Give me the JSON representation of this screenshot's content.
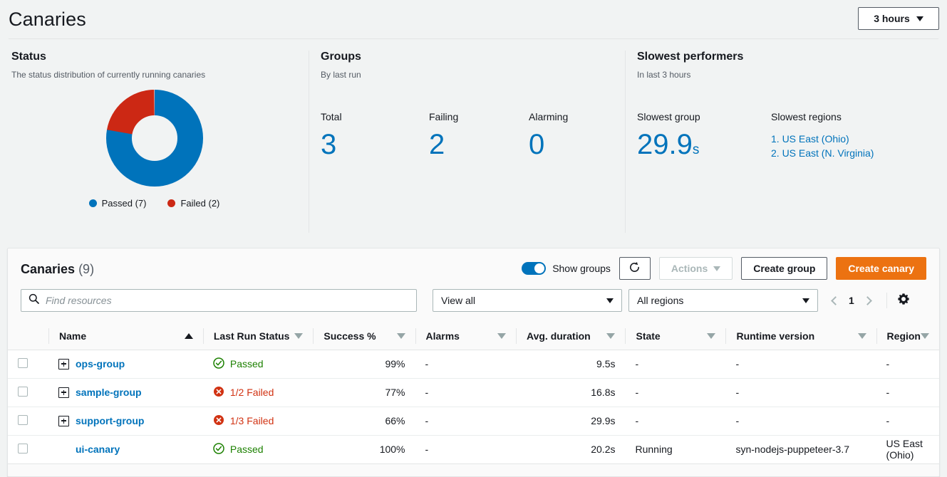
{
  "header": {
    "title": "Canaries",
    "time_range": "3 hours",
    "time_range_icon": "chevron-down-icon"
  },
  "status_panel": {
    "heading": "Status",
    "subheading": "The status distribution of currently running canaries"
  },
  "groups_panel": {
    "heading": "Groups",
    "subheading": "By last run",
    "metrics": [
      {
        "label": "Total",
        "value": "3"
      },
      {
        "label": "Failing",
        "value": "2",
        "icon": "warning-triangle-icon"
      },
      {
        "label": "Alarming",
        "value": "0"
      }
    ]
  },
  "performers_panel": {
    "heading": "Slowest performers",
    "subheading": "In last 3 hours",
    "slowest_group_label": "Slowest group",
    "slowest_group_value": "29.9",
    "slowest_group_unit": "s",
    "slowest_regions_label": "Slowest regions",
    "regions": [
      "1. US East (Ohio)",
      "2. US East (N. Virginia)"
    ]
  },
  "table_card": {
    "title": "Canaries",
    "count": "(9)",
    "toggle_label": "Show groups",
    "refresh_icon": "refresh-icon",
    "actions_label": "Actions",
    "create_group_label": "Create group",
    "create_canary_label": "Create canary",
    "search_placeholder": "Find resources",
    "search_value": "",
    "search_icon": "search-icon",
    "view_filter": "View all",
    "region_filter": "All regions",
    "page_number": "1",
    "settings_icon": "gear-icon",
    "columns": [
      {
        "label": "Name",
        "sort": "asc"
      },
      {
        "label": "Last Run Status",
        "sort": "none"
      },
      {
        "label": "Success %",
        "sort": "none"
      },
      {
        "label": "Alarms",
        "sort": "none"
      },
      {
        "label": "Avg. duration",
        "sort": "none"
      },
      {
        "label": "State",
        "sort": "none"
      },
      {
        "label": "Runtime version",
        "sort": "none"
      },
      {
        "label": "Region",
        "sort": "none"
      }
    ],
    "rows": [
      {
        "name": "ops-group",
        "is_group": true,
        "status": "Passed",
        "status_kind": "passed",
        "success": "99%",
        "alarms": "-",
        "duration": "9.5s",
        "state": "-",
        "runtime": "-",
        "region": "-"
      },
      {
        "name": "sample-group",
        "is_group": true,
        "status": "1/2 Failed",
        "status_kind": "failed",
        "success": "77%",
        "alarms": "-",
        "duration": "16.8s",
        "state": "-",
        "runtime": "-",
        "region": "-"
      },
      {
        "name": "support-group",
        "is_group": true,
        "status": "1/3 Failed",
        "status_kind": "failed",
        "success": "66%",
        "alarms": "-",
        "duration": "29.9s",
        "state": "-",
        "runtime": "-",
        "region": "-"
      },
      {
        "name": "ui-canary",
        "is_group": false,
        "status": "Passed",
        "status_kind": "passed",
        "success": "100%",
        "alarms": "-",
        "duration": "20.2s",
        "state": "Running",
        "runtime": "syn-nodejs-puppeteer-3.7",
        "region": "US East (Ohio)"
      }
    ]
  },
  "chart_data": {
    "type": "pie",
    "title": "Status",
    "subtitle": "The status distribution of currently running canaries",
    "categories": [
      "Passed",
      "Failed"
    ],
    "values": [
      7,
      2
    ],
    "labels": [
      "Passed (7)",
      "Failed (2)"
    ],
    "colors": [
      "#0073bb",
      "#cc2814"
    ],
    "donut": true,
    "legend_position": "bottom"
  },
  "colors": {
    "accent_blue": "#0073bb",
    "danger_red": "#cc2814",
    "success_green": "#1d8102",
    "primary_orange": "#ec7211",
    "page_bg": "#f1f3f3"
  }
}
